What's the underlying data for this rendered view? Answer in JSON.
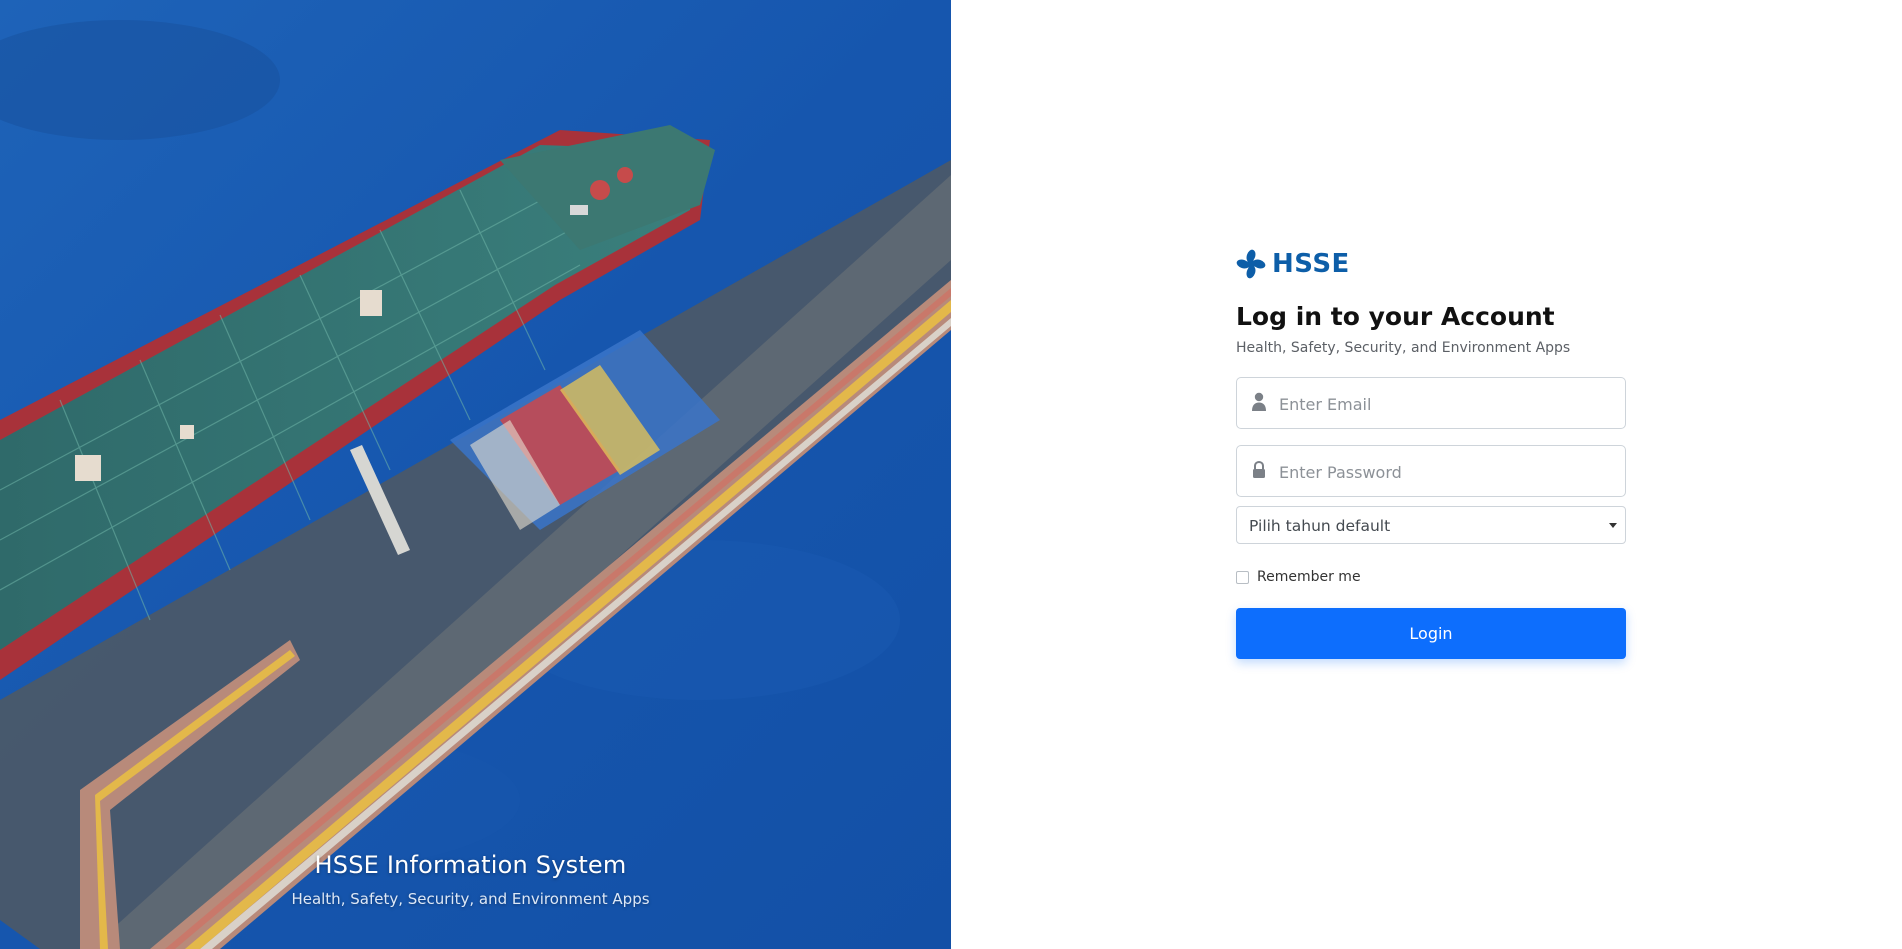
{
  "hero": {
    "title": "HSSE Information System",
    "subtitle": "Health, Safety, Security, and Environment Apps"
  },
  "brand": {
    "name": "HSSE",
    "icon": "hsse-cross-logo",
    "color": "#0d5ea8"
  },
  "login": {
    "heading": "Log in to your Account",
    "subheading": "Health, Safety, Security, and Environment Apps",
    "email": {
      "placeholder": "Enter Email",
      "value": "",
      "icon": "user-icon"
    },
    "password": {
      "placeholder": "Enter Password",
      "value": "",
      "icon": "lock-icon"
    },
    "year_select": {
      "selected": "Pilih tahun default"
    },
    "remember_label": "Remember me",
    "remember_checked": false,
    "submit_label": "Login",
    "accent_color": "#0d6efd"
  }
}
